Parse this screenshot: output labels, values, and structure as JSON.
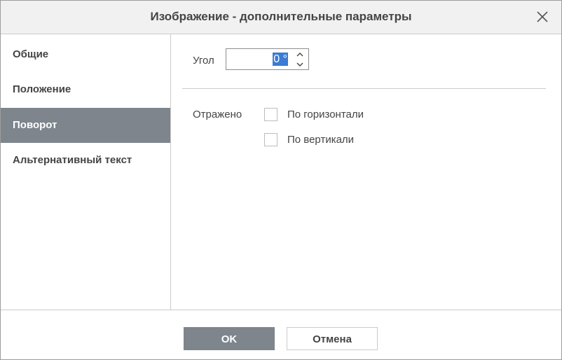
{
  "dialog": {
    "title": "Изображение - дополнительные параметры"
  },
  "sidebar": {
    "items": [
      {
        "label": "Общие",
        "active": false
      },
      {
        "label": "Положение",
        "active": false
      },
      {
        "label": "Поворот",
        "active": true
      },
      {
        "label": "Альтернативный текст",
        "active": false
      }
    ]
  },
  "rotation": {
    "angle_label": "Угол",
    "angle_value": "0 °",
    "flip_label": "Отражено",
    "flip_horizontal_label": "По горизонтали",
    "flip_horizontal_checked": false,
    "flip_vertical_label": "По вертикали",
    "flip_vertical_checked": false
  },
  "footer": {
    "ok_label": "OK",
    "cancel_label": "Отмена"
  },
  "colors": {
    "accent": "#7e858c",
    "selection": "#3a7bd5"
  }
}
